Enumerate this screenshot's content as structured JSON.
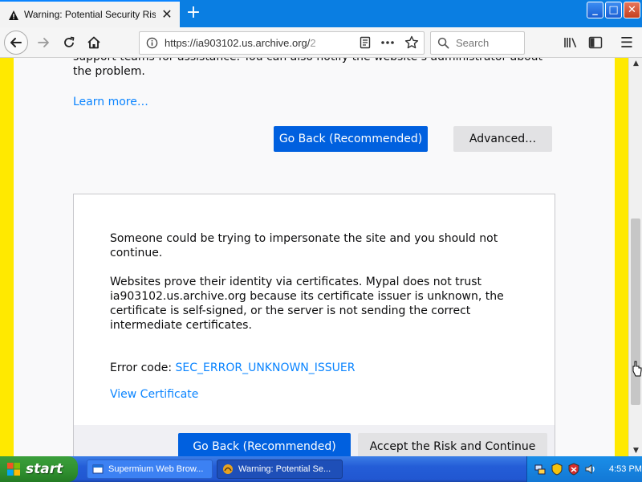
{
  "browser": {
    "tab": {
      "title": "Warning: Potential Security Risk Ahead"
    },
    "window_controls": {
      "minimize": "_",
      "maximize": "□",
      "close": "✕"
    },
    "newtab_label": "+",
    "url": {
      "value": "https://ia903102.us.archive.org/",
      "tail": "2"
    },
    "search": {
      "placeholder": "Search"
    },
    "menu_label": "☰"
  },
  "page": {
    "intro_text": "support teams for assistance. You can also notify the website’s administrator about the problem.",
    "learn_more": "Learn more…",
    "go_back_label": "Go Back (Recommended)",
    "advanced_label": "Advanced…",
    "advanced_panel": {
      "paragraph1": "Someone could be trying to impersonate the site and you should not continue.",
      "paragraph2": "Websites prove their identity via certificates. Mypal does not trust ia903102.us.archive.org because its certificate issuer is unknown, the certificate is self-signed, or the server is not sending the correct intermediate certificates.",
      "error_code_label": "Error code:",
      "error_code": "SEC_ERROR_UNKNOWN_ISSUER",
      "view_certificate": "View Certificate",
      "go_back_label": "Go Back (Recommended)",
      "accept_label": "Accept the Risk and Continue"
    }
  },
  "taskbar": {
    "start_label": "start",
    "items": [
      {
        "label": "Supermium Web Brow..."
      },
      {
        "label": "Warning: Potential Se..."
      }
    ],
    "clock": "4:53 PM"
  },
  "colors": {
    "accent_blue": "#0060df",
    "link_blue": "#0a84ff",
    "warning_yellow": "#ffe900",
    "titlebar_blue": "#0a7ee2"
  }
}
